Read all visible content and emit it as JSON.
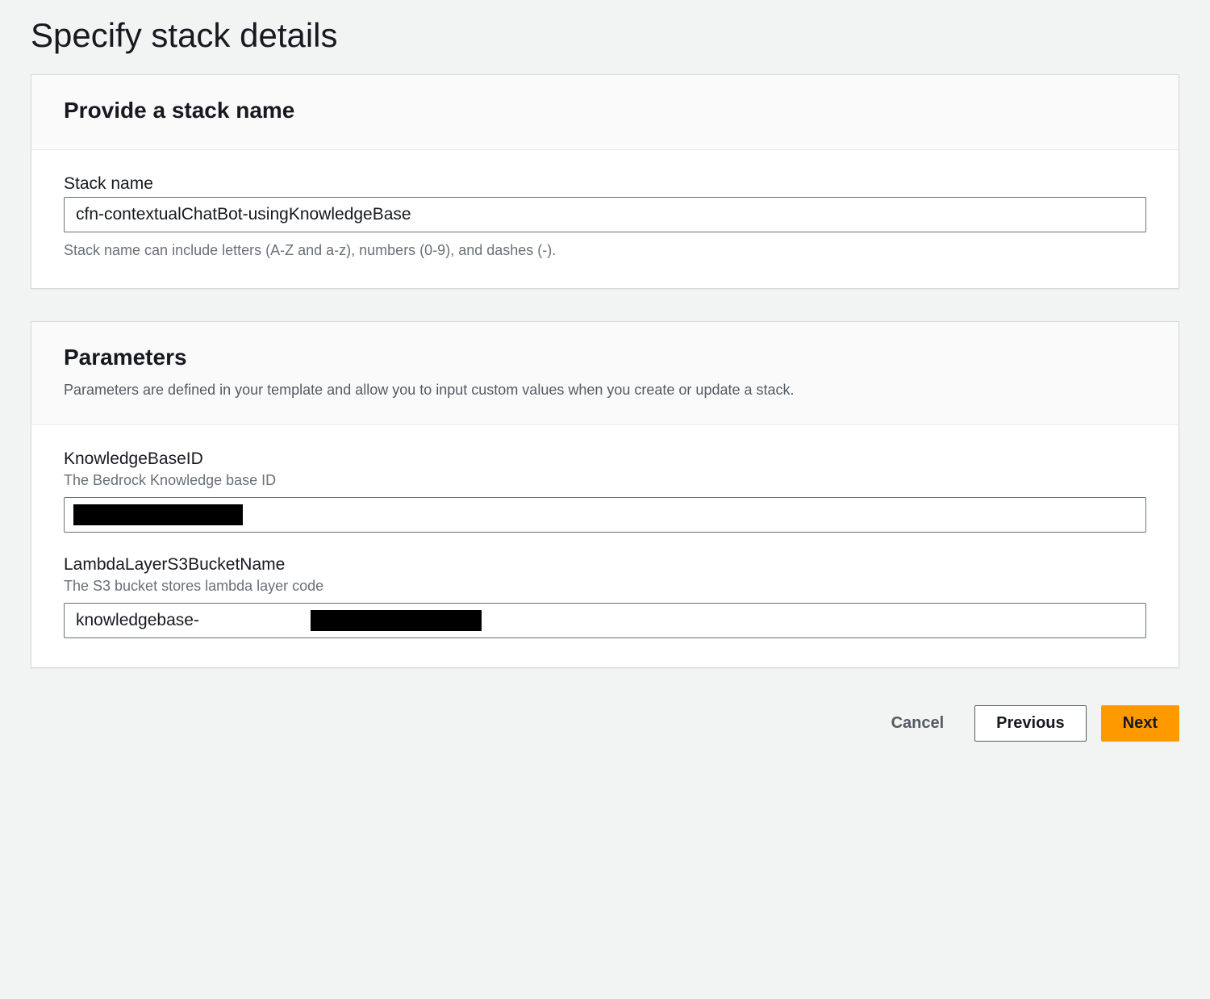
{
  "page": {
    "title": "Specify stack details"
  },
  "stackName": {
    "panelTitle": "Provide a stack name",
    "label": "Stack name",
    "value": "cfn-contextualChatBot-usingKnowledgeBase",
    "helper": "Stack name can include letters (A-Z and a-z), numbers (0-9), and dashes (-)."
  },
  "parameters": {
    "panelTitle": "Parameters",
    "panelSubtitle": "Parameters are defined in your template and allow you to input custom values when you create or update a stack.",
    "knowledgeBaseId": {
      "label": "KnowledgeBaseID",
      "description": "The Bedrock Knowledge base ID",
      "value": ""
    },
    "lambdaLayerBucket": {
      "label": "LambdaLayerS3BucketName",
      "description": "The S3 bucket stores lambda layer code",
      "value": "knowledgebase-"
    }
  },
  "buttons": {
    "cancel": "Cancel",
    "previous": "Previous",
    "next": "Next"
  }
}
